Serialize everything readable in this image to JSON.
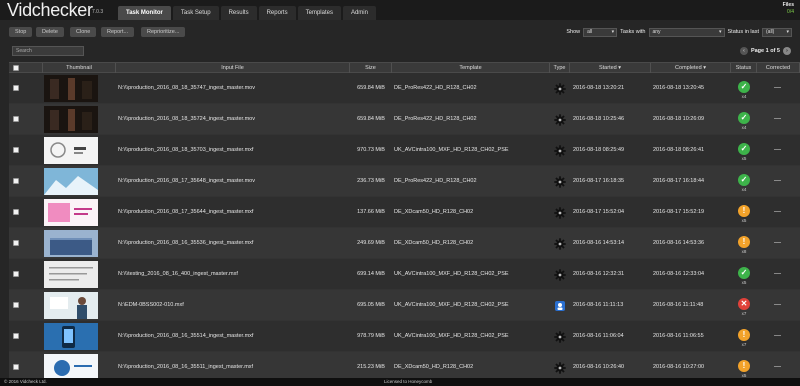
{
  "app": {
    "name": "Vidchecker",
    "version": "7.0.3"
  },
  "tabs": [
    "Task Monitor",
    "Task Setup",
    "Results",
    "Reports",
    "Templates",
    "Admin"
  ],
  "files": {
    "label": "Files",
    "count": "0/4"
  },
  "toolbar": {
    "buttons": [
      "Stop",
      "Delete",
      "Clone",
      "Report...",
      "Reprioritize..."
    ]
  },
  "filters": {
    "show_label": "Show",
    "show_value": "all",
    "tasks_with_label": "Tasks with",
    "tasks_with_value": "any",
    "status_in_last_label": "Status in last",
    "status_in_last_value": "(all)"
  },
  "search": {
    "placeholder": "Search"
  },
  "pager": {
    "text": "Page 1 of 5"
  },
  "columns": [
    "Thumbnail",
    "Input File",
    "Size",
    "Template",
    "Type",
    "Started",
    "Completed",
    "Status",
    "Corrected"
  ],
  "sort_arrow": "▾",
  "status_colors": {
    "pass": "#3db34a",
    "warn": "#f2a22a",
    "fail": "#e0413a"
  },
  "rows": [
    {
      "file": "N:\\\\\\production_2016_08_18_35747_ingest_master.mov",
      "size": "659.84 MiB",
      "template": "DE_ProRes422_HD_R128_CH02",
      "type": "gear-icon",
      "started": "2016-08-18 13:20:21",
      "completed": "2016-08-18 13:20:45",
      "status": "pass",
      "count": "x4",
      "corrected": "—",
      "thumb": "dark-scene"
    },
    {
      "file": "N:\\\\\\production_2016_08_18_35724_ingest_master.mov",
      "size": "659.84 MiB",
      "template": "DE_ProRes422_HD_R128_CH02",
      "type": "gear-icon",
      "started": "2016-08-18 10:25:46",
      "completed": "2016-08-18 10:26:09",
      "status": "pass",
      "count": "x4",
      "corrected": "—",
      "thumb": "dark-scene"
    },
    {
      "file": "N:\\\\\\production_2016_08_18_35703_ingest_master.mxf",
      "size": "970.73 MiB",
      "template": "UK_AVCintra100_MXF_HD_R128_CH02_PSE",
      "type": "gear-icon",
      "started": "2016-08-18 08:25:49",
      "completed": "2016-08-18 08:26:41",
      "status": "pass",
      "count": "x5",
      "corrected": "—",
      "thumb": "white-logo"
    },
    {
      "file": "N:\\\\\\production_2016_08_17_35648_ingest_master.mov",
      "size": "236.73 MiB",
      "template": "DE_ProRes422_HD_R128_CH02",
      "type": "gear-icon",
      "started": "2016-08-17 16:18:35",
      "completed": "2016-08-17 16:18:44",
      "status": "pass",
      "count": "x4",
      "corrected": "—",
      "thumb": "ice-blue"
    },
    {
      "file": "N:\\\\\\production_2016_08_17_35644_ingest_master.mxf",
      "size": "137.66 MiB",
      "template": "DE_XDcam50_HD_R128_CH02",
      "type": "gear-icon",
      "started": "2016-08-17 15:52:04",
      "completed": "2016-08-17 15:52:19",
      "status": "warn",
      "count": "x5",
      "corrected": "—",
      "thumb": "pink-text"
    },
    {
      "file": "N:\\\\\\production_2016_08_16_35536_ingest_master.mxf",
      "size": "249.69 MiB",
      "template": "DE_XDcam50_HD_R128_CH02",
      "type": "gear-icon",
      "started": "2016-08-16 14:53:14",
      "completed": "2016-08-16 14:53:36",
      "status": "warn",
      "count": "x8",
      "corrected": "—",
      "thumb": "building"
    },
    {
      "file": "N:\\\\\\testing_2016_08_16_400_ingest_master.mxf",
      "size": "699.14 MiB",
      "template": "UK_AVCintra100_MXF_HD_R128_CH02_PSE",
      "type": "gear-icon",
      "started": "2016-08-16 12:32:31",
      "completed": "2016-08-16 12:33:04",
      "status": "pass",
      "count": "x5",
      "corrected": "—",
      "thumb": "grey-lines"
    },
    {
      "file": "N:\\EDM-0BSS002-010.mxf",
      "size": "695.05 MiB",
      "template": "UK_AVCintra100_MXF_HD_R128_CH02_PSE",
      "type": "person-icon",
      "started": "2016-08-16 11:11:13",
      "completed": "2016-08-16 11:11:48",
      "status": "fail",
      "count": "x7",
      "corrected": "—",
      "thumb": "presenter"
    },
    {
      "file": "N:\\\\\\production_2016_08_16_35514_ingest_master.mxf",
      "size": "978.79 MiB",
      "template": "UK_AVCintra100_MXF_HD_R128_CH02_PSE",
      "type": "gear-icon",
      "started": "2016-08-16 11:06:04",
      "completed": "2016-08-16 11:06:55",
      "status": "warn",
      "count": "x7",
      "corrected": "—",
      "thumb": "phone"
    },
    {
      "file": "N:\\\\\\production_2016_08_16_35511_ingest_master.mxf",
      "size": "215.23 MiB",
      "template": "DE_XDcam50_HD_R128_CH02",
      "type": "gear-icon",
      "started": "2016-08-16 10:26:40",
      "completed": "2016-08-16 10:27:00",
      "status": "warn",
      "count": "x5",
      "corrected": "—",
      "thumb": "blue-white"
    }
  ],
  "footer": {
    "copyright": "© 2016 Vidcheck Ltd.",
    "license": "Licensed to Honeycomb"
  }
}
